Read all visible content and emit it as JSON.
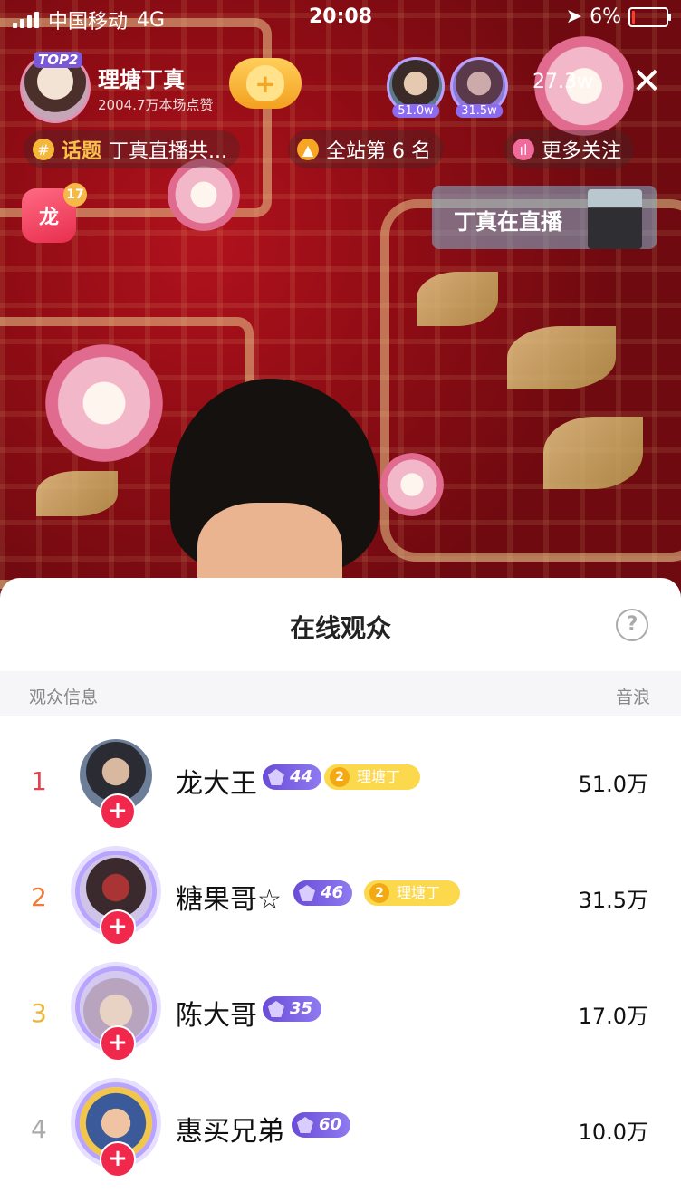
{
  "status_bar": {
    "carrier": "中国移动",
    "network": "4G",
    "time": "20:08",
    "battery": "6%",
    "battery_level": 0.06
  },
  "host": {
    "badge": "TOP2",
    "name": "理塘丁真",
    "likes": "2004.7万本场点赞"
  },
  "top_viewers": [
    {
      "score": "51.0w"
    },
    {
      "score": "31.5w"
    }
  ],
  "online_count": "27.3w",
  "chips": {
    "topic_prefix": "话题",
    "topic": "丁真直播共...",
    "rank": "全站第 6 名",
    "more": "更多关注"
  },
  "lucky_bag": {
    "glyph": "龙",
    "count": "17"
  },
  "live_card": {
    "title": "丁真在直播"
  },
  "sheet": {
    "title": "在线观众",
    "help_glyph": "?",
    "col_left": "观众信息",
    "col_right": "音浪"
  },
  "viewers": [
    {
      "rank": "1",
      "name": "龙大王",
      "level": "44",
      "fan_level": "2",
      "fan_club": "理塘丁",
      "score": "51.0万",
      "rank_color": "#e0454f"
    },
    {
      "rank": "2",
      "name": "糖果哥☆",
      "level": "46",
      "fan_level": "2",
      "fan_club": "理塘丁",
      "score": "31.5万",
      "rank_color": "#ef7a3a"
    },
    {
      "rank": "3",
      "name": "陈大哥",
      "level": "35",
      "score": "17.0万",
      "rank_color": "#eab63a"
    },
    {
      "rank": "4",
      "name": "惠买兄弟",
      "level": "60",
      "score": "10.0万",
      "rank_color": "#aaaaaa"
    }
  ],
  "colors": {
    "accent_red": "#f0294c",
    "level_purple": "#6a4bd8",
    "fan_yellow": "#fbd84c"
  },
  "icons": [
    "signal-icon",
    "location-icon",
    "battery-icon",
    "heart-plus-icon",
    "close-icon",
    "hashtag-icon",
    "flame-icon",
    "chart-icon",
    "help-icon",
    "add-icon",
    "diamond-icon"
  ]
}
